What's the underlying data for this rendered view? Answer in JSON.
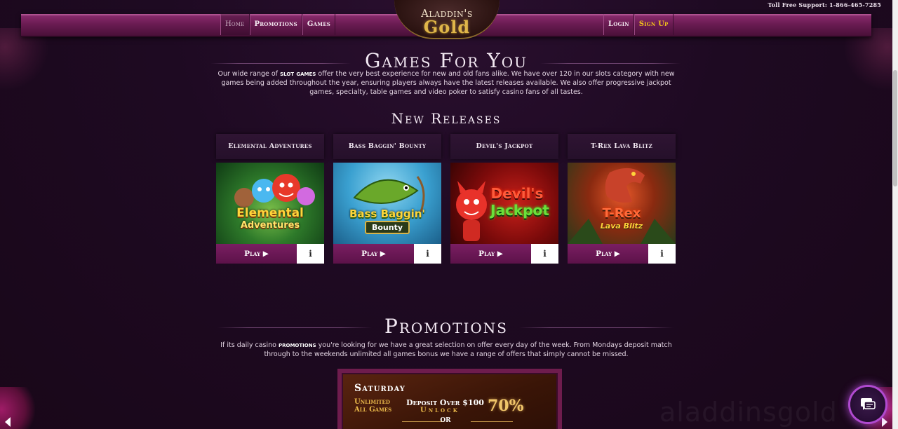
{
  "header": {
    "support": "Toll Free Support: 1-866-465-7285",
    "logo_line1": "Aladdin's",
    "logo_line2": "Gold",
    "nav_left": [
      "Home",
      "Promotions",
      "Games"
    ],
    "nav_right": [
      "Login",
      "Sign Up"
    ]
  },
  "games_section": {
    "title": "Games For You",
    "intro_pre": "Our wide range of ",
    "intro_bold": "slot games",
    "intro_post": " offer the very best experience for new and old fans alike. We have over 120 in our slots category with new games being added throughout the year, ensuring players always have the latest releases available. We also offer progressive jackpot games, specialty, table games and video poker to satisfy casino fans of all tastes.",
    "new_releases_title": "New Releases"
  },
  "games": [
    {
      "name": "Elemental Adventures",
      "art": [
        "Elemental",
        "Adventures"
      ],
      "play": "Play",
      "info": "i"
    },
    {
      "name": "Bass Baggin' Bounty",
      "art": [
        "Bass Baggin'",
        "Bounty"
      ],
      "play": "Play",
      "info": "i"
    },
    {
      "name": "Devil's Jackpot",
      "art": [
        "Devil's",
        "Jackpot"
      ],
      "play": "Play",
      "info": "i"
    },
    {
      "name": "T-Rex Lava Blitz",
      "art": [
        "T-Rex",
        "Lava Blitz"
      ],
      "play": "Play",
      "info": "i"
    }
  ],
  "promotions_section": {
    "title": "Promotions",
    "intro_pre": "If its daily casino ",
    "intro_bold": "promotions",
    "intro_post": " you're looking for we have a great selection on offer every day of the week. From Mondays deposit match through to the weekends unlimited all games bonus we have a range of offers that simply cannot be missed."
  },
  "promo_card": {
    "day": "Saturday",
    "line_a1": "Unlimited",
    "line_a2": "All Games",
    "deposit": "Deposit Over $100",
    "unlock": "Unlock",
    "percent": "70%",
    "or": "OR"
  },
  "watermark": "aladdinsgold",
  "colors": {
    "background": "#1d0a20",
    "nav_band": "#6a1b52",
    "accent_gold": "#e0b64a",
    "signup": "#f2c21a",
    "play_button": "#6a1856",
    "chat_glow": "#b04ad0"
  },
  "icons": [
    "chat-icon",
    "play-triangle-icon",
    "info-icon",
    "left-arrow-icon",
    "right-arrow-icon"
  ]
}
